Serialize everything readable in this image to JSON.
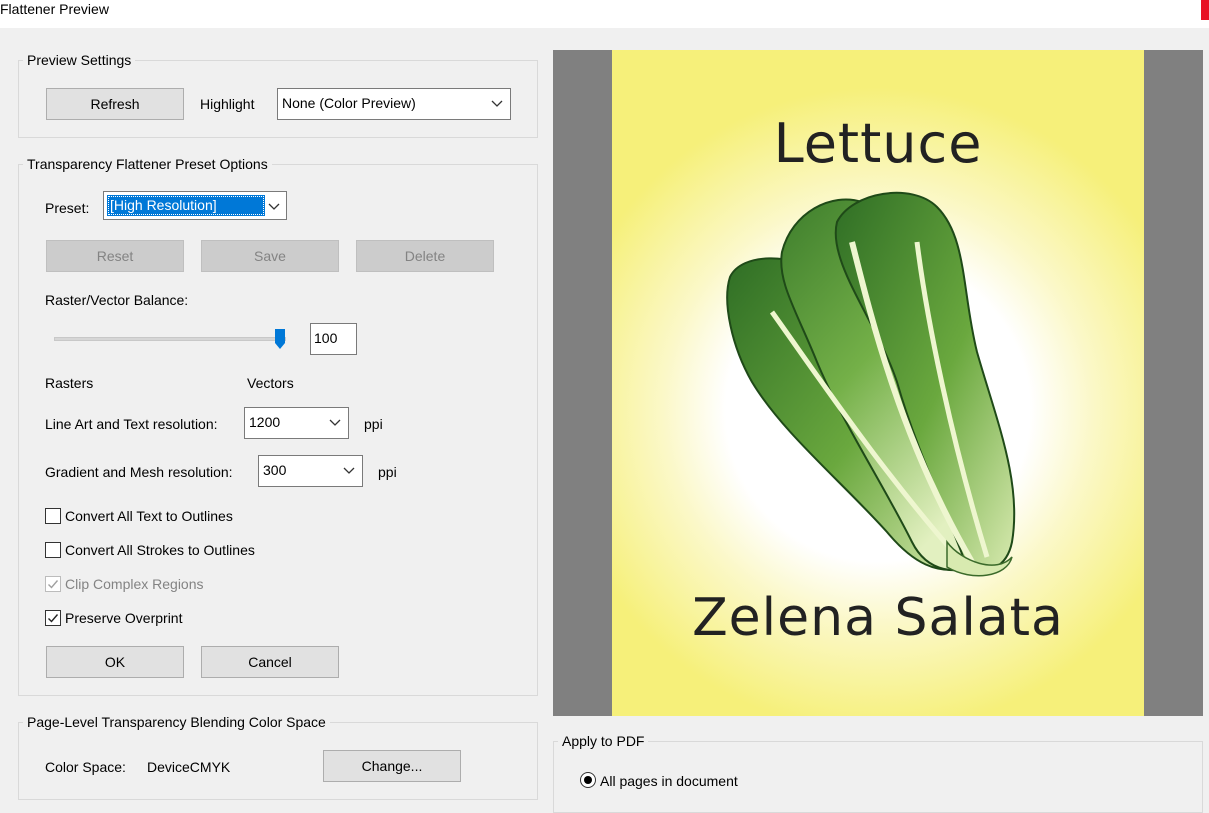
{
  "window": {
    "title": "Flattener Preview"
  },
  "preview_settings": {
    "legend": "Preview Settings",
    "refresh_label": "Refresh",
    "highlight_label": "Highlight",
    "highlight_value": "None (Color Preview)"
  },
  "preset_options": {
    "legend": "Transparency Flattener Preset Options",
    "preset_label": "Preset:",
    "preset_value": "[High Resolution]",
    "reset_label": "Reset",
    "save_label": "Save",
    "delete_label": "Delete",
    "balance_label": "Raster/Vector Balance:",
    "balance_value": "100",
    "balance_fraction": 1.0,
    "rasters_label": "Rasters",
    "vectors_label": "Vectors",
    "line_art_label": "Line Art and Text resolution:",
    "line_art_value": "1200",
    "line_art_unit": "ppi",
    "gradient_label": "Gradient and Mesh resolution:",
    "gradient_value": "300",
    "gradient_unit": "ppi",
    "convert_text_label": "Convert All Text to Outlines",
    "convert_text_checked": false,
    "convert_strokes_label": "Convert All Strokes to Outlines",
    "convert_strokes_checked": false,
    "clip_label": "Clip Complex Regions",
    "clip_checked": true,
    "clip_disabled": true,
    "overprint_label": "Preserve Overprint",
    "overprint_checked": true,
    "ok_label": "OK",
    "cancel_label": "Cancel"
  },
  "blending": {
    "legend": "Page-Level Transparency Blending Color Space",
    "color_space_label": "Color Space:",
    "color_space_value": "DeviceCMYK",
    "change_label": "Change..."
  },
  "preview": {
    "top_text": "Lettuce",
    "bottom_text": "Zelena Salata",
    "background_color": "#f6f07a",
    "lettuce_color": "#2f6e25"
  },
  "apply": {
    "legend": "Apply to PDF",
    "all_pages_label": "All pages in document",
    "all_pages_selected": true
  },
  "icons": [
    "chevron-down-icon",
    "checkmark-icon",
    "slider-thumb",
    "radio-selected",
    "lettuce-illustration"
  ]
}
